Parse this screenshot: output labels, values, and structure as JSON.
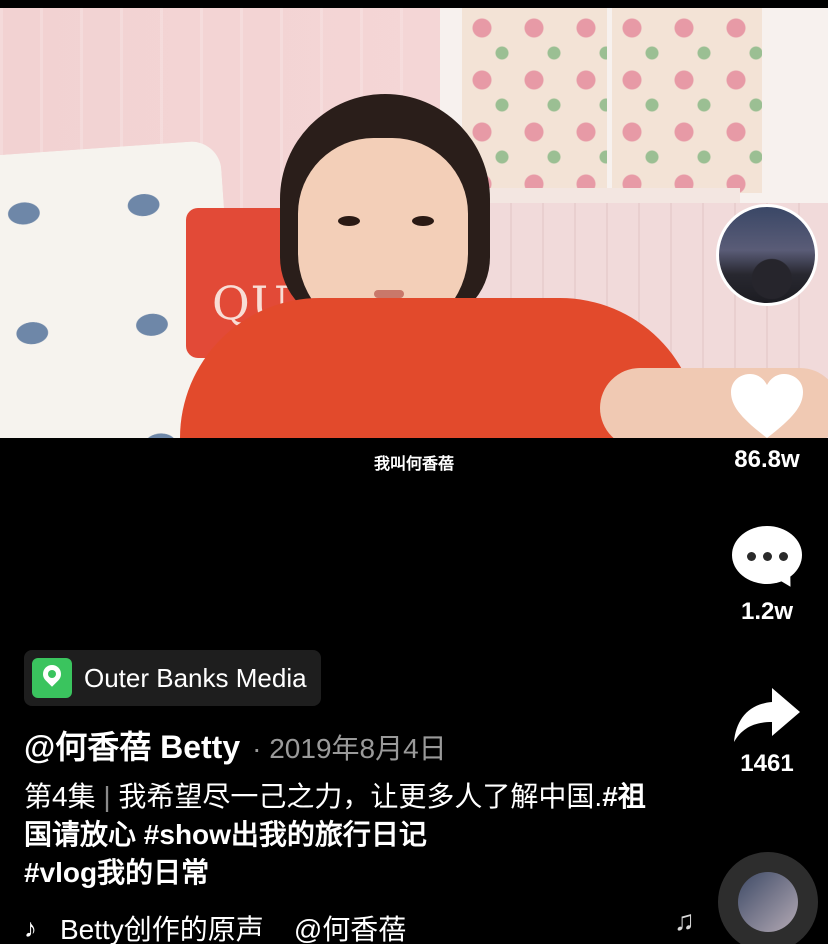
{
  "video": {
    "pillow_print_text": "QUA",
    "subtitle": "我叫何香蓓"
  },
  "rail": {
    "likes": "86.8w",
    "comments": "1.2w",
    "shares": "1461",
    "icons": [
      "avatar",
      "heart-icon",
      "comment-icon",
      "share-icon",
      "music-disc"
    ]
  },
  "location": {
    "label": "Outer Banks Media",
    "icon": "location-pin-icon",
    "accent": "#3ac45e"
  },
  "post": {
    "author": "@何香蓓 Betty",
    "date": "· 2019年8月4日",
    "episode": "第4集",
    "separator": "|",
    "caption_text": "我希望尽一己之力，让更多人了解中国.",
    "hashtag_1": "#祖国请放心",
    "hashtag_2": "#show出我的旅行日记",
    "hashtag_3": "#vlog我的日常"
  },
  "sound": {
    "title": "Betty创作的原声",
    "artist": "@何香蓓"
  },
  "colors": {
    "background": "#000000",
    "shirt": "#e24a2c",
    "date_gray": "#9a9a9a"
  }
}
